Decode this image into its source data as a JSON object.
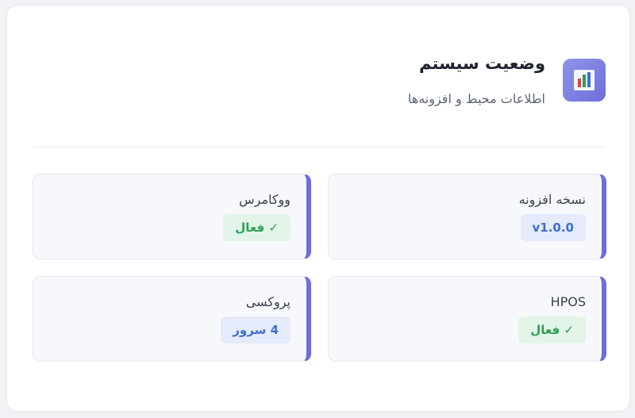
{
  "header": {
    "title": "وضعیت سیستم",
    "subtitle": "اطلاعات محیط و افزونه‌ها",
    "icon": "bar-chart-icon"
  },
  "colors": {
    "accent": "#6c6fd8",
    "success_bg": "#e3f5e9",
    "success_text": "#2f9e57",
    "info_bg": "#e5ebfa",
    "info_text": "#3d6fd1"
  },
  "items": [
    {
      "label": "نسخه افزونه",
      "value": "v1.0.0",
      "status": "info"
    },
    {
      "label": "ووکامرس",
      "value": "✓ فعال",
      "status": "success"
    },
    {
      "label": "HPOS",
      "value": "✓ فعال",
      "status": "success"
    },
    {
      "label": "پروکسی",
      "value": "4 سرور",
      "status": "info"
    }
  ]
}
